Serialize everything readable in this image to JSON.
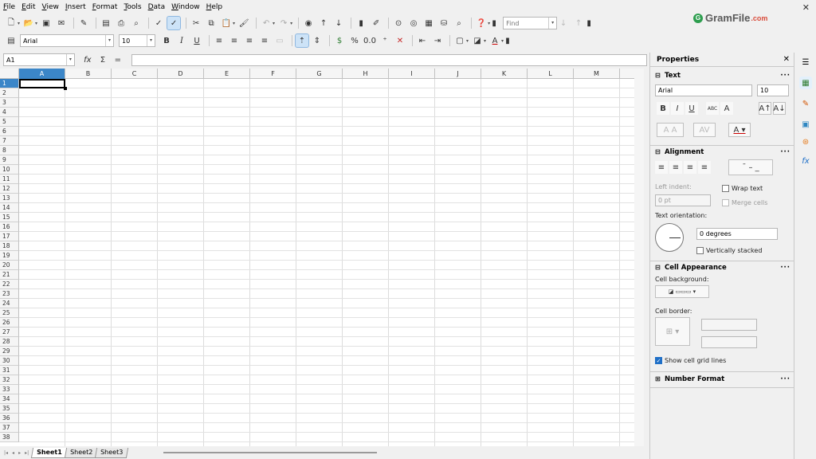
{
  "menu": [
    "File",
    "Edit",
    "View",
    "Insert",
    "Format",
    "Tools",
    "Data",
    "Window",
    "Help"
  ],
  "logo": {
    "text": "GramFile",
    "suffix": ".com"
  },
  "toolbar": {
    "find_placeholder": "Find",
    "font_name": "Arial",
    "font_size": "10"
  },
  "formula_bar": {
    "cell_ref": "A1",
    "formula": ""
  },
  "columns": [
    "A",
    "B",
    "C",
    "D",
    "E",
    "F",
    "G",
    "H",
    "I",
    "J",
    "K",
    "L",
    "M"
  ],
  "rows": [
    "1",
    "2",
    "3",
    "4",
    "5",
    "6",
    "7",
    "8",
    "9",
    "10",
    "11",
    "12",
    "13",
    "14",
    "15",
    "16",
    "17",
    "18",
    "19",
    "20",
    "21",
    "22",
    "23",
    "24",
    "25",
    "26",
    "27",
    "28",
    "29",
    "30",
    "31",
    "32",
    "33",
    "34",
    "35",
    "36",
    "37",
    "38"
  ],
  "sheets": [
    "Sheet1",
    "Sheet2",
    "Sheet3"
  ],
  "sidebar": {
    "title": "Properties",
    "text_section": "Text",
    "font_name": "Arial",
    "font_size": "10",
    "alignment_section": "Alignment",
    "left_indent_label": "Left indent:",
    "left_indent_value": "0 pt",
    "wrap_text": "Wrap text",
    "merge_cells": "Merge cells",
    "text_orientation_label": "Text orientation:",
    "orientation_value": "0 degrees",
    "vertically_stacked": "Vertically stacked",
    "cell_appearance_section": "Cell Appearance",
    "cell_background_label": "Cell background:",
    "cell_border_label": "Cell border:",
    "show_grid_lines": "Show cell grid lines",
    "number_format_section": "Number Format"
  },
  "colors": {
    "selection": "#3b86c8",
    "accent_check": "#1f6fc7"
  }
}
